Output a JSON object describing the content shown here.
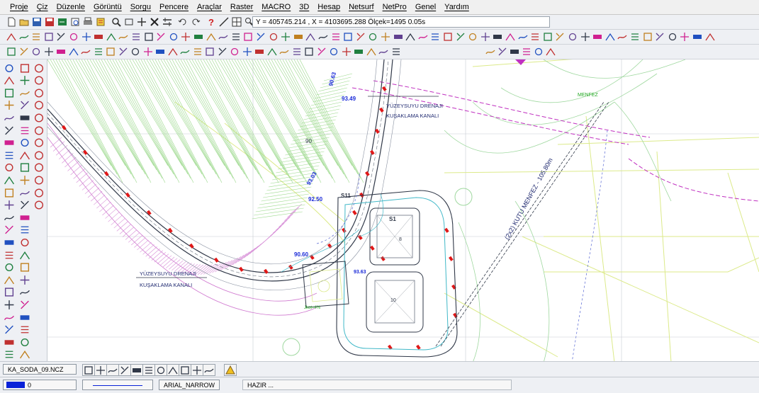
{
  "menu": [
    "Proje",
    "Çiz",
    "Düzenle",
    "Görüntü",
    "Sorgu",
    "Pencere",
    "Araçlar",
    "Raster",
    "MACRO",
    "3D",
    "Hesap",
    "Netsurf",
    "NetPro",
    "Genel",
    "Yardım"
  ],
  "coordinates_readout": "Y = 405745.214 , X = 4103695.288  Ölçek=1495  0.05s",
  "drawing_tab": "KA_SODA_09.NCZ",
  "layer_value": "0",
  "font_name": "ARIAL_NARROW",
  "status": "HAZIR ...",
  "annotations": {
    "drain_1_line1": "YÜZEYSUYU DRENAJI",
    "drain_1_line2": "KUŞAKLAMA KANALI",
    "drain_2_line1": "YÜZEYSUYU DRENAJI",
    "drain_2_line2": "KUŞAKLAMA KANALI",
    "culvert": "(2x2) KUTU MENFEZ - 105.80m",
    "menfez": "MENFEZ",
    "grade_90": "90",
    "elev_1": "90.63",
    "elev_2": "93.49",
    "elev_3": "93.03",
    "elev_4": "92.50",
    "elev_5": "90.60",
    "elev_6": "93.63",
    "label_s11": "S11",
    "label_s1": "S1",
    "small_note": "Jkot=4%",
    "num_10": "10",
    "num_8": "8"
  },
  "colors": {
    "magenta": "#c030c0",
    "green": "#22a822",
    "lime": "#d8e890",
    "cyan": "#40b8c8",
    "red": "#e01818",
    "blue": "#1a2ad8",
    "navy": "#202a70",
    "gray": "#9aa0a8",
    "layer_swatch": "#0a22d8"
  }
}
